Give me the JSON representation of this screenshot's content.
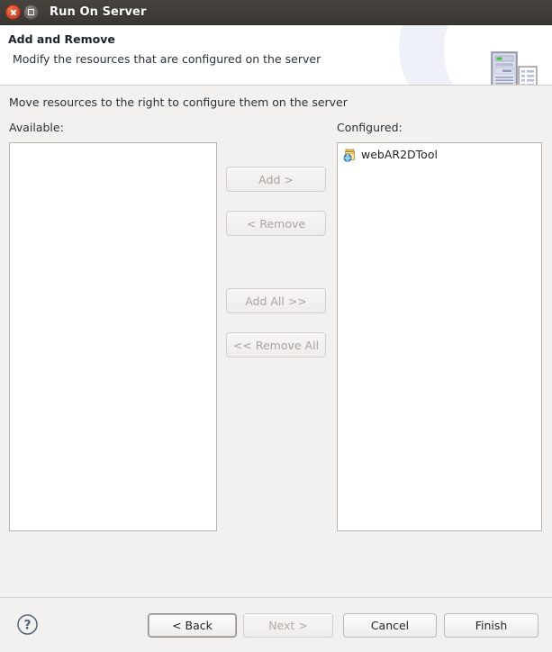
{
  "window": {
    "title": "Run On Server",
    "close_icon": "close-icon",
    "maximize_icon": "maximize-icon"
  },
  "header": {
    "title": "Add and Remove",
    "subtitle": "Modify the resources that are configured on the server",
    "icon": "server-and-document-icon"
  },
  "body": {
    "instruction": "Move resources to the right to configure them on the server",
    "available": {
      "label": "Available:",
      "items": []
    },
    "configured": {
      "label": "Configured:",
      "items": [
        {
          "label": "webAR2DTool",
          "icon": "web-module-project-icon"
        }
      ]
    },
    "transfer_buttons": [
      {
        "label": "Add >",
        "name": "add-button",
        "enabled": false
      },
      {
        "label": "< Remove",
        "name": "remove-button",
        "enabled": false
      },
      {
        "label": "Add All >>",
        "name": "add-all-button",
        "enabled": false
      },
      {
        "label": "<< Remove All",
        "name": "remove-all-button",
        "enabled": false
      }
    ]
  },
  "footer": {
    "help_icon": "help-question-icon",
    "back_label": "< Back",
    "next_label": "Next >",
    "cancel_label": "Cancel",
    "finish_label": "Finish"
  },
  "colors": {
    "titlebar": "#3a3733",
    "close_button": "#d8472a",
    "header_background": "#ffffff",
    "dialog_background": "#f2f1f0",
    "list_background": "#ffffff",
    "disabled_text": "#a9a49d"
  }
}
